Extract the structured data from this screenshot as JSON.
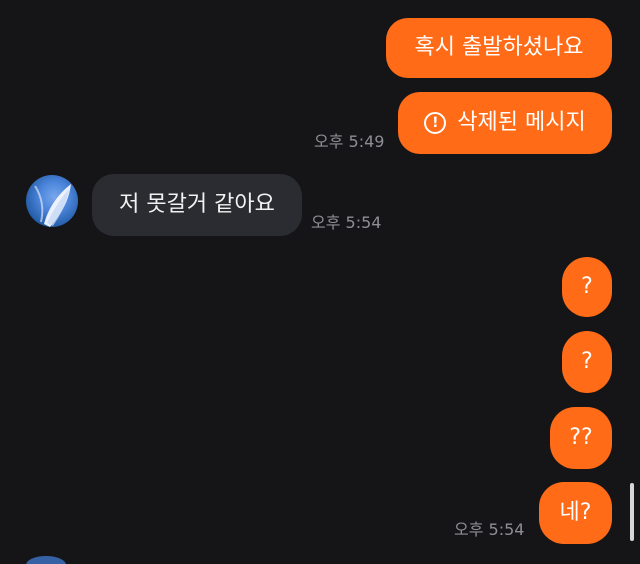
{
  "conversation": {
    "messages": [
      {
        "id": "m1",
        "sender": "me",
        "text": "혹시 출발하셨나요"
      },
      {
        "id": "m2",
        "sender": "me",
        "text": "삭제된 메시지",
        "deleted": true,
        "icon": "alert-circle-icon",
        "time": "오후 5:49"
      },
      {
        "id": "m3",
        "sender": "other",
        "text": "저 못갈거 같아요",
        "time": "오후 5:54"
      },
      {
        "id": "m4",
        "sender": "me",
        "text": "?"
      },
      {
        "id": "m5",
        "sender": "me",
        "text": "?"
      },
      {
        "id": "m6",
        "sender": "me",
        "text": "??"
      },
      {
        "id": "m7",
        "sender": "me",
        "text": "네?",
        "time": "오후 5:54"
      }
    ]
  },
  "ui": {
    "deleted_icon_glyph": "!"
  },
  "colors": {
    "background": "#151518",
    "outgoing_bubble": "#ff6b17",
    "incoming_bubble": "#2b2c31",
    "timestamp": "#8e8e93"
  }
}
